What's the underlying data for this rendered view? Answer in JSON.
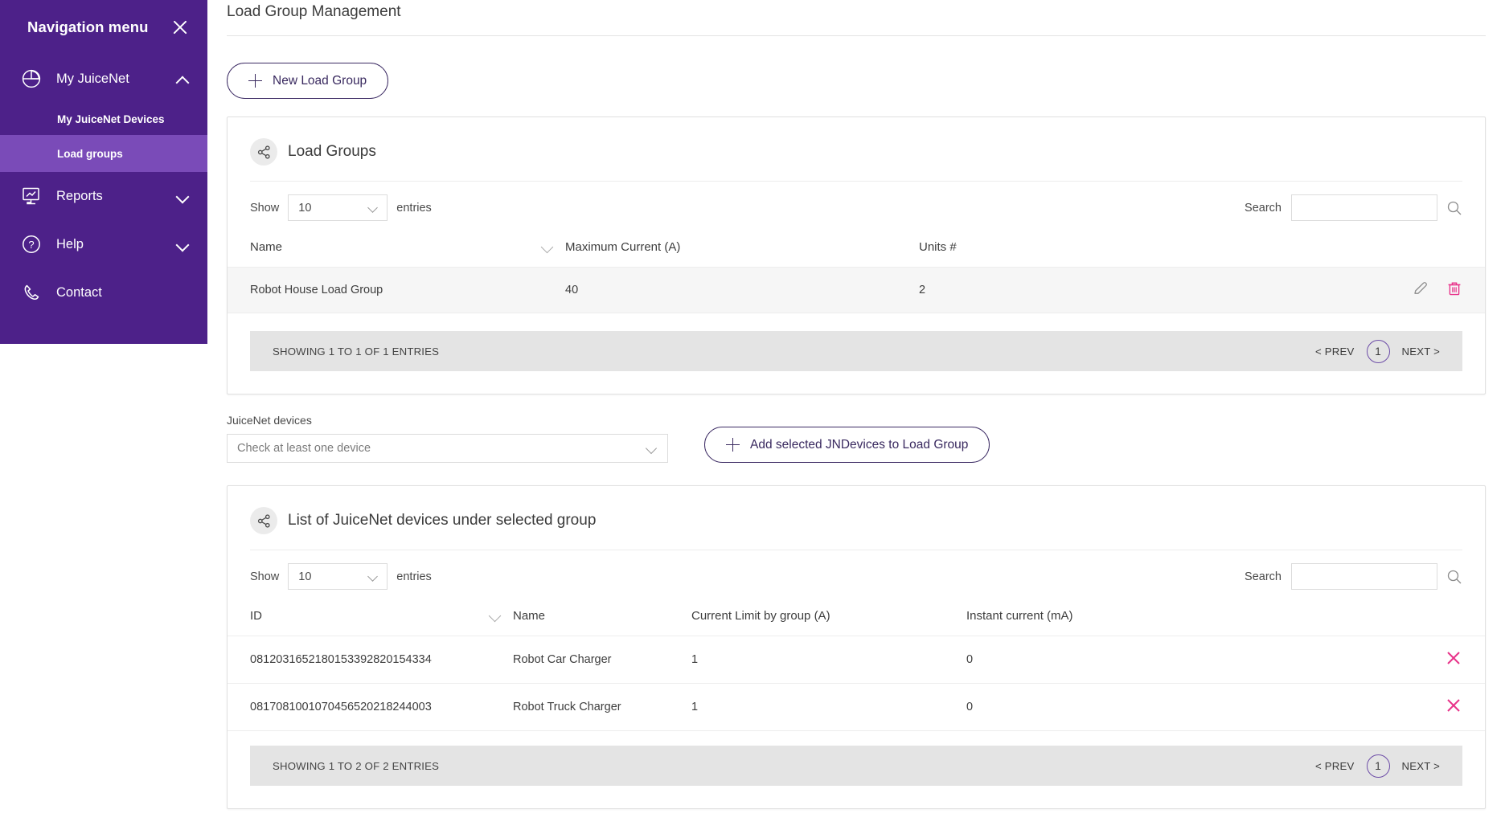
{
  "sidebar": {
    "title": "Navigation menu",
    "close_icon": "close-icon",
    "items": [
      {
        "label": "My JuiceNet",
        "icon": "clock-dial-icon",
        "chevron": "chevron-up-icon",
        "children": [
          {
            "label": "My JuiceNet Devices",
            "active": false
          },
          {
            "label": "Load groups",
            "active": true
          }
        ]
      },
      {
        "label": "Reports",
        "icon": "monitor-chart-icon",
        "chevron": "chevron-down-icon"
      },
      {
        "label": "Help",
        "icon": "question-circle-icon",
        "chevron": "chevron-down-icon"
      },
      {
        "label": "Contact",
        "icon": "phone-icon",
        "chevron": ""
      }
    ],
    "colors": {
      "bg": "#4d2189",
      "active_bg": "#7a4bb8"
    }
  },
  "main": {
    "page_title": "Load Group Management",
    "new_group_button": "New Load Group"
  },
  "load_groups_card": {
    "icon": "share-nodes-icon",
    "title": "Load Groups",
    "show_label": "Show",
    "entries_label": "entries",
    "page_size": "10",
    "search_label": "Search",
    "search_value": "",
    "search_placeholder": "",
    "search_icon": "search-icon",
    "columns": [
      "Name",
      "Maximum Current (A)",
      "Units #"
    ],
    "rows": [
      {
        "name": "Robot House Load Group",
        "max_current": "40",
        "units": "2",
        "edit_icon": "pencil-icon",
        "delete_icon": "trash-icon"
      }
    ],
    "footer": {
      "info": "SHOWING 1 TO 1 OF 1 ENTRIES",
      "prev": "< PREV",
      "page": "1",
      "next": "NEXT >"
    }
  },
  "device_selector": {
    "label": "JuiceNet devices",
    "value": "Check at least one device",
    "chevron": "chevron-down-icon",
    "add_button": "Add selected JNDevices to Load Group"
  },
  "devices_card": {
    "icon": "share-nodes-icon",
    "title": "List of JuiceNet devices under selected group",
    "show_label": "Show",
    "entries_label": "entries",
    "page_size": "10",
    "search_label": "Search",
    "search_value": "",
    "search_placeholder": "",
    "search_icon": "search-icon",
    "columns": [
      "ID",
      "Name",
      "Current Limit by group (A)",
      "Instant current (mA)"
    ],
    "rows": [
      {
        "id": "0812031652180153392820154334",
        "name": "Robot Car Charger",
        "current_limit": "1",
        "instant_current": "0",
        "remove_icon": "x-icon"
      },
      {
        "id": "0817081001070456520218244003",
        "name": "Robot Truck Charger",
        "current_limit": "1",
        "instant_current": "0",
        "remove_icon": "x-icon"
      }
    ],
    "footer": {
      "info": "SHOWING 1 TO 2 OF 2 ENTRIES",
      "prev": "< PREV",
      "page": "1",
      "next": "NEXT >"
    }
  },
  "colors": {
    "purple": "#4d2189",
    "purple_active": "#7a4bb8",
    "accent_pink": "#e8338a",
    "pager_ring": "#6e4ea8",
    "footer_bg": "#e4e4e4"
  }
}
